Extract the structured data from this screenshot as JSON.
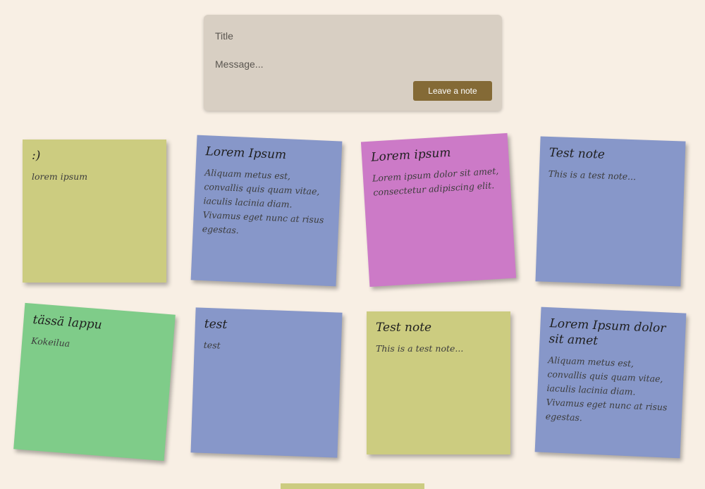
{
  "form": {
    "title_placeholder": "Title",
    "message_placeholder": "Message...",
    "submit_label": "Leave a note"
  },
  "colors": {
    "background": "#f8efe4",
    "form_bg": "#d8cfc3",
    "button": "#846a36",
    "yellow": "#cccc80",
    "blue": "#8797c9",
    "pink": "#cc7ac7",
    "green": "#7fcc89"
  },
  "notes": [
    {
      "title": ":)",
      "body": "lorem ipsum",
      "color": "yellow"
    },
    {
      "title": "Lorem Ipsum",
      "body": "Aliquam metus est, convallis quis quam vitae, iaculis lacinia diam. Vivamus eget nunc at risus egestas.",
      "color": "blue"
    },
    {
      "title": "Lorem ipsum",
      "body": "Lorem ipsum dolor sit amet, consectetur adipiscing elit.",
      "color": "pink"
    },
    {
      "title": "Test note",
      "body": "This is a test note...",
      "color": "blue"
    },
    {
      "title": "tässä lappu",
      "body": "Kokeilua",
      "color": "green"
    },
    {
      "title": "test",
      "body": "test",
      "color": "blue"
    },
    {
      "title": "Test note",
      "body": "This is a test note...",
      "color": "yellow"
    },
    {
      "title": "Lorem Ipsum dolor sit amet",
      "body": "Aliquam metus est, convallis quis quam vitae, iaculis lacinia diam. Vivamus eget nunc at risus egestas.",
      "color": "blue"
    },
    {
      "title": "",
      "body": "",
      "color": "yellow"
    }
  ]
}
